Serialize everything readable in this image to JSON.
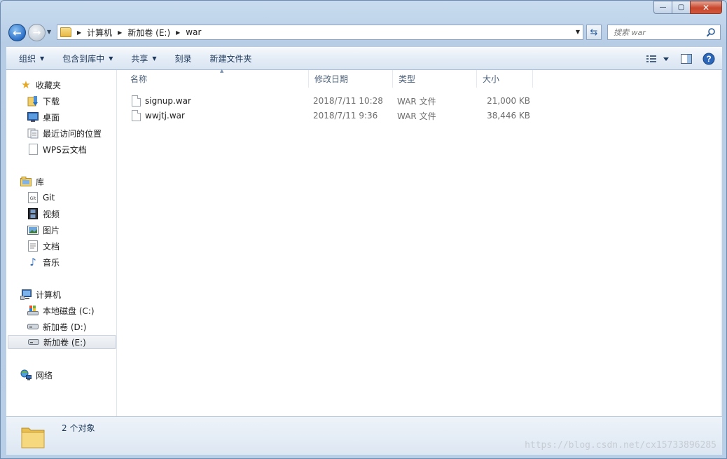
{
  "window": {
    "caption": {
      "minimize": "—",
      "maximize": "▢",
      "close": "✕"
    }
  },
  "nav": {
    "breadcrumb": [
      "计算机",
      "新加卷 (E:)",
      "war"
    ],
    "search_placeholder": "搜索 war"
  },
  "toolbar": {
    "items": [
      {
        "label": "组织",
        "dropdown": true
      },
      {
        "label": "包含到库中",
        "dropdown": true
      },
      {
        "label": "共享",
        "dropdown": true
      },
      {
        "label": "刻录",
        "dropdown": false
      },
      {
        "label": "新建文件夹",
        "dropdown": false
      }
    ],
    "icons": [
      "view-options-icon",
      "preview-pane-icon",
      "help-icon"
    ]
  },
  "sidebar": {
    "favorites": {
      "label": "收藏夹",
      "items": [
        "下载",
        "桌面",
        "最近访问的位置",
        "WPS云文档"
      ]
    },
    "libraries": {
      "label": "库",
      "items": [
        "Git",
        "视频",
        "图片",
        "文档",
        "音乐"
      ]
    },
    "computer": {
      "label": "计算机",
      "items": [
        "本地磁盘 (C:)",
        "新加卷 (D:)",
        "新加卷 (E:)"
      ],
      "selected": "新加卷 (E:)"
    },
    "network": {
      "label": "网络"
    }
  },
  "columns": [
    "名称",
    "修改日期",
    "类型",
    "大小"
  ],
  "files": [
    {
      "name": "signup.war",
      "modified": "2018/7/11 10:28",
      "type": "WAR 文件",
      "size": "21,000 KB"
    },
    {
      "name": "wwjtj.war",
      "modified": "2018/7/11 9:36",
      "type": "WAR 文件",
      "size": "38,446 KB"
    }
  ],
  "details": {
    "count_text": "2 个对象"
  },
  "watermark": "https://blog.csdn.net/cx15733896285",
  "colors": {
    "accent": "#1e395b",
    "selection": "#e4e8ee",
    "window_frame": "#b9cfe7"
  }
}
